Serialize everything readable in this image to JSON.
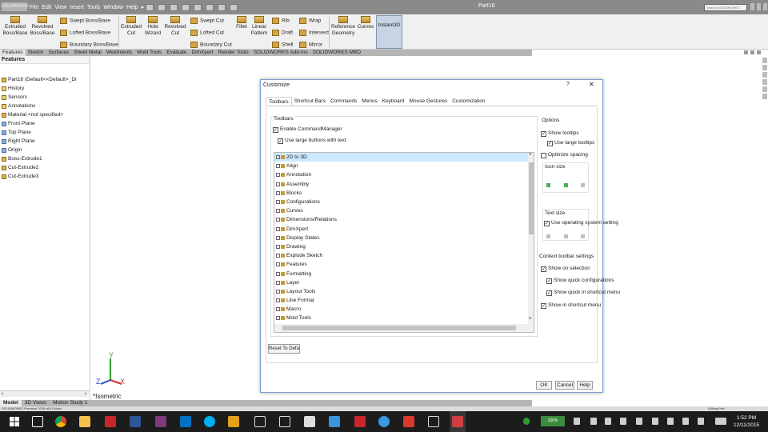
{
  "app": {
    "logo_text": "SOLIDWORKS",
    "menu": [
      "File",
      "Edit",
      "View",
      "Insert",
      "Tools",
      "Window",
      "Help",
      "▸"
    ],
    "document_title": "Part16",
    "search_placeholder": "Search SOLIDWORKS"
  },
  "ribbon": {
    "extruded_boss": "Extruded\nBoss/Base",
    "revolved_boss": "Revolved\nBoss/Base",
    "swept_boss": "Swept Boss/Base",
    "lofted_boss": "Lofted Boss/Base",
    "boundary_boss": "Boundary Boss/Base",
    "extruded_cut": "Extruded\nCut",
    "hole_wizard": "Hole\nWizard",
    "revolved_cut": "Revolved\nCut",
    "swept_cut": "Swept Cut",
    "lofted_cut": "Lofted Cut",
    "boundary_cut": "Boundary Cut",
    "fillet": "Fillet",
    "linear_pattern": "Linear\nPattern",
    "rib": "Rib",
    "draft": "Draft",
    "shell": "Shell",
    "wrap": "Wrap",
    "intersect": "Intersect",
    "mirror": "Mirror",
    "reference_geometry": "Reference\nGeometry",
    "curves": "Curves",
    "instant3d": "Instant3D"
  },
  "command_tabs": [
    "Features",
    "Sketch",
    "Surfaces",
    "Sheet Metal",
    "Weldments",
    "Mold Tools",
    "Evaluate",
    "DimXpert",
    "Render Tools",
    "SOLIDWORKS Add-Ins",
    "SOLIDWORKS MBD"
  ],
  "feature_manager": {
    "header": "Features",
    "items": [
      {
        "label": "Part16  (Default<<Default>_Di",
        "icon": "part"
      },
      {
        "label": "History",
        "icon": "folder"
      },
      {
        "label": "Sensors",
        "icon": "folder"
      },
      {
        "label": "Annotations",
        "icon": "folder"
      },
      {
        "label": "Material <not specified>",
        "icon": "material"
      },
      {
        "label": "Front Plane",
        "icon": "plane"
      },
      {
        "label": "Top Plane",
        "icon": "plane"
      },
      {
        "label": "Right Plane",
        "icon": "plane"
      },
      {
        "label": "Origin",
        "icon": "origin"
      },
      {
        "label": "Boss-Extrude1",
        "icon": "feature"
      },
      {
        "label": "Cut-Extrude2",
        "icon": "feature"
      },
      {
        "label": "Cut-Extrude3",
        "icon": "feature"
      }
    ]
  },
  "model_tabs": [
    "Model",
    "3D Views",
    "Motion Study 1"
  ],
  "view_label": "*Isometric",
  "status_bar": {
    "left": "SOLIDWORKS Premium 2016 x64 Edition",
    "right": "Editing Part"
  },
  "dialog": {
    "title": "Customize",
    "help": "?",
    "close": "✕",
    "tabs": [
      "Toolbars",
      "Shortcut Bars",
      "Commands",
      "Menus",
      "Keyboard",
      "Mouse Gestures",
      "Customization"
    ],
    "active_tab": "Toolbars",
    "toolbars_group_label": "Toolbars",
    "enable_cmdmgr": "Enable CommandManager",
    "use_large_buttons": "Use large buttons with text",
    "toolbar_list": [
      "2D to 3D",
      "Align",
      "Annotation",
      "Assembly",
      "Blocks",
      "Configurations",
      "Curves",
      "Dimensions/Relations",
      "DimXpert",
      "Display States",
      "Drawing",
      "Explode Sketch",
      "Features",
      "Formatting",
      "Layer",
      "Layout Tools",
      "Line Format",
      "Macro",
      "Mold Tools"
    ],
    "selected_toolbar": "2D to 3D",
    "options_label": "Options",
    "show_tooltips": "Show tooltips",
    "use_large_tooltips": "Use large tooltips",
    "optimize_spacing": "Optimize spacing",
    "icon_size_label": "Icon size",
    "text_size_label": "Text size",
    "use_operating": "Use operating system setting",
    "context_label": "Context toolbar settings",
    "show_on_selection": "Show on selection",
    "show_quick_configs": "Show quick configurations",
    "show_quick_in": "Show quick in shortcut menu",
    "show_in_shortcut": "Show in shortcut menu",
    "reset_button": "Reset To Defaults",
    "ok": "OK",
    "cancel": "Cancel",
    "help_button": "Help"
  },
  "taskbar": {
    "battery": "100%",
    "time": "1:52 PM",
    "date": "12/11/2015"
  },
  "colors": {
    "titlebar": "#8a8a8a",
    "dialog_border": "#7c9fd0",
    "selection": "#cde8ff",
    "taskbar": "#1c1c1c",
    "axis_x": "#d33030",
    "axis_y": "#2e9b2e",
    "axis_z": "#2a4fc9"
  }
}
